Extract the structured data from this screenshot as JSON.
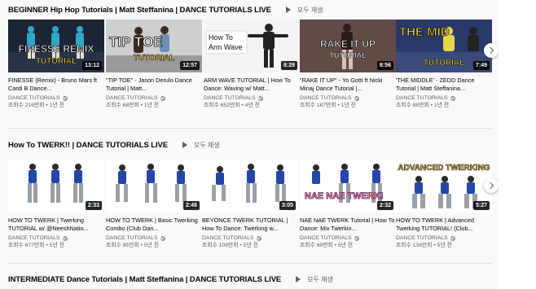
{
  "play_all_label": "모두 재생",
  "shelves": [
    {
      "title": "BEGINNER Hip Hop Tutorials | Matt Steffanina | DANCE TUTORIALS LIVE",
      "videos": [
        {
          "title": "FINESSE (Remix) - Bruno Mars ft Cardi B Dance...",
          "channel": "DANCE TUTORIALS",
          "views": "조회수 216만회",
          "age": "1년 전",
          "duration": "13:12",
          "thumb_text": [
            "FINESSE REMIX",
            "TUTORIAL"
          ]
        },
        {
          "title": "\"TIP TOE\" - Jason Derulo Dance Tutorial | Matt...",
          "channel": "DANCE TUTORIALS",
          "views": "조회수 68만회",
          "age": "1년 전",
          "duration": "12:57",
          "thumb_text": [
            "TIP TOE",
            "TUTORIAL"
          ]
        },
        {
          "title": "ARM WAVE TUTORIAL | How To Dance: Waving w/ Matt...",
          "channel": "DANCE TUTORIALS",
          "views": "조회수 652만회",
          "age": "4년 전",
          "duration": "8:29",
          "thumb_text": [
            "How To",
            "Arm Wave"
          ]
        },
        {
          "title": "\"RAKE IT UP\" - Yo Gotti ft Nicki Minaj Dance Tutorial |...",
          "channel": "DANCE TUTORIALS",
          "views": "조회수 187만회",
          "age": "1년 전",
          "duration": "8:56",
          "thumb_text": [
            "RAKE IT UP",
            "TUTORIAL"
          ]
        },
        {
          "title": "'THE MIDDLE' - ZEDD Dance Tutorial | Matt Steffanina...",
          "channel": "DANCE TUTORIALS",
          "views": "조회수 88만회",
          "age": "1년 전",
          "duration": "7:49",
          "thumb_text": [
            "THE MID",
            "TUTORIAL"
          ]
        }
      ]
    },
    {
      "title": "How To TWERK!! | DANCE TUTORIALS LIVE",
      "videos": [
        {
          "title": "HOW TO TWERK | Twerking TUTORIAL w/ @NeeshNatio...",
          "channel": "DANCE TUTORIALS",
          "views": "조회수 677만회",
          "age": "5년 전",
          "duration": "2:33",
          "thumb_text": []
        },
        {
          "title": "HOW TO TWERK | Basic Twerking Combo (Club Dan...",
          "channel": "DANCE TUTORIALS",
          "views": "조회수 95만회",
          "age": "5년 전",
          "duration": "2:46",
          "thumb_text": []
        },
        {
          "title": "BEYONCE TWERK TUTORIAL | How To Dance: Twerking w...",
          "channel": "DANCE TUTORIALS",
          "views": "조회수 108만회",
          "age": "5년 전",
          "duration": "3:05",
          "thumb_text": []
        },
        {
          "title": "NAE NAE TWERK Tutorial | How To Dance: Mix Twerkin...",
          "channel": "DANCE TUTORIALS",
          "views": "조회수 69만회",
          "age": "5년 전",
          "duration": "2:32",
          "thumb_text": [
            "NAE NAE TWERK!"
          ]
        },
        {
          "title": "HOW TO TWERK | Advanced Twerking TUTORIAL! (Club...",
          "channel": "DANCE TUTORIALS",
          "views": "조회수 136만회",
          "age": "5년 전",
          "duration": "5:27",
          "thumb_text": [
            "ADVANCED TWERKING"
          ]
        }
      ]
    },
    {
      "title": "INTERMEDIATE Dance Tutorials | Matt Steffanina | DANCE TUTORIALS LIVE",
      "videos": []
    }
  ]
}
